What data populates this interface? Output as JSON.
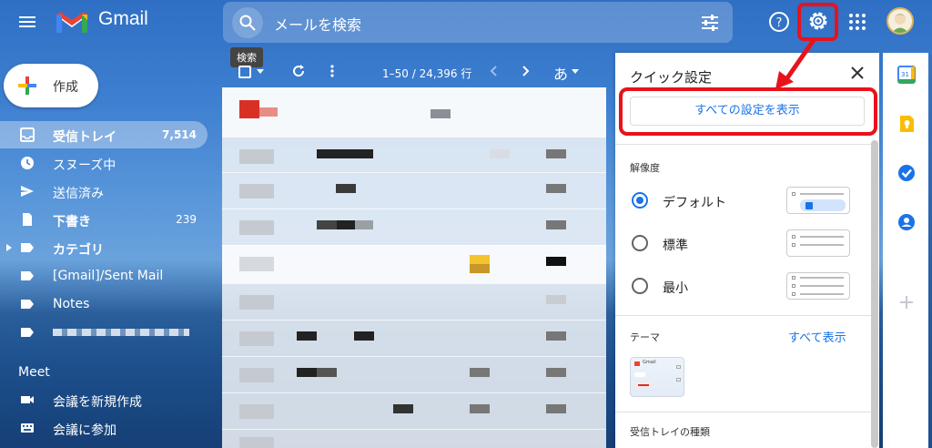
{
  "app": {
    "name": "Gmail"
  },
  "search": {
    "placeholder": "メールを検索",
    "tooltip": "検索"
  },
  "compose": {
    "label": "作成"
  },
  "sidebar": {
    "items": [
      {
        "label": "受信トレイ",
        "count": "7,514",
        "icon": "inbox-icon",
        "active": true,
        "bold": true
      },
      {
        "label": "スヌーズ中",
        "count": "",
        "icon": "clock-icon",
        "active": false,
        "bold": false
      },
      {
        "label": "送信済み",
        "count": "",
        "icon": "send-icon",
        "active": false,
        "bold": false
      },
      {
        "label": "下書き",
        "count": "239",
        "icon": "draft-icon",
        "active": false,
        "bold": true
      },
      {
        "label": "カテゴリ",
        "count": "",
        "icon": "label-icon",
        "active": false,
        "bold": true
      },
      {
        "label": "[Gmail]/Sent Mail",
        "count": "",
        "icon": "label-icon",
        "active": false,
        "bold": false
      },
      {
        "label": "Notes",
        "count": "",
        "icon": "label-icon",
        "active": false,
        "bold": false
      }
    ],
    "meet": {
      "title": "Meet",
      "items": [
        {
          "label": "会議を新規作成",
          "icon": "video-icon"
        },
        {
          "label": "会議に参加",
          "icon": "keyboard-icon"
        }
      ]
    }
  },
  "list_toolbar": {
    "range": "1–50 / 24,396 行",
    "input_tool": "あ"
  },
  "quick_settings": {
    "title": "クイック設定",
    "all_settings_button": "すべての設定を表示",
    "density_title": "解像度",
    "density_options": [
      "デフォルト",
      "標準",
      "最小"
    ],
    "density_selected": "デフォルト",
    "theme_title": "テーマ",
    "theme_show_all": "すべて表示",
    "theme_thumb_label": "Gmail",
    "inbox_type_title": "受信トレイの種類"
  },
  "colors": {
    "accent": "#1a73e8",
    "highlight": "#e8121b"
  }
}
